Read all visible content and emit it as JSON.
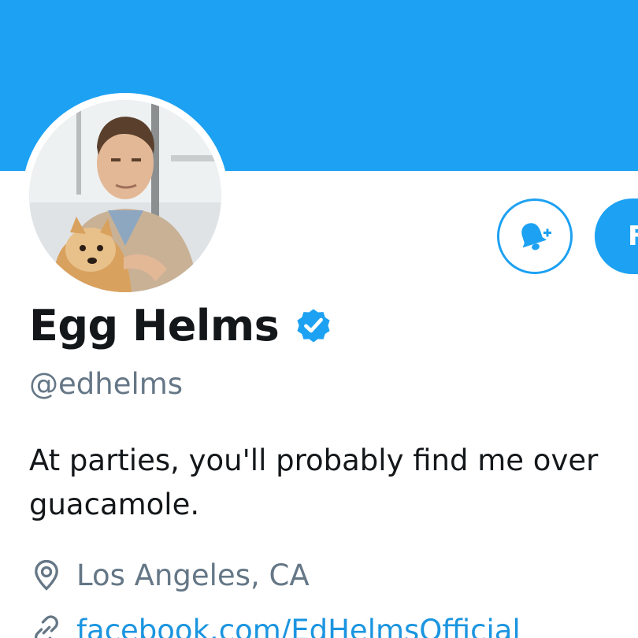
{
  "colors": {
    "brand": "#1da1f2",
    "link": "#1b95e0",
    "text": "#14171a",
    "secondary_text": "#657786"
  },
  "header": {
    "banner_color": "#1da1f2"
  },
  "profile": {
    "avatar_icon": "avatar-photo",
    "display_name": "Egg Helms",
    "verified_icon": "verified-badge-icon",
    "handle": "@edhelms",
    "bio_lines": [
      "At parties, you'll probably find me over",
      "guacamole."
    ],
    "location_icon": "location-pin-icon",
    "location": "Los Angeles, CA",
    "website_icon": "link-icon",
    "website": "facebook.com/EdHelmsOfficial"
  },
  "actions": {
    "notifications_icon": "bell-plus-icon",
    "follow_label": "Following"
  }
}
